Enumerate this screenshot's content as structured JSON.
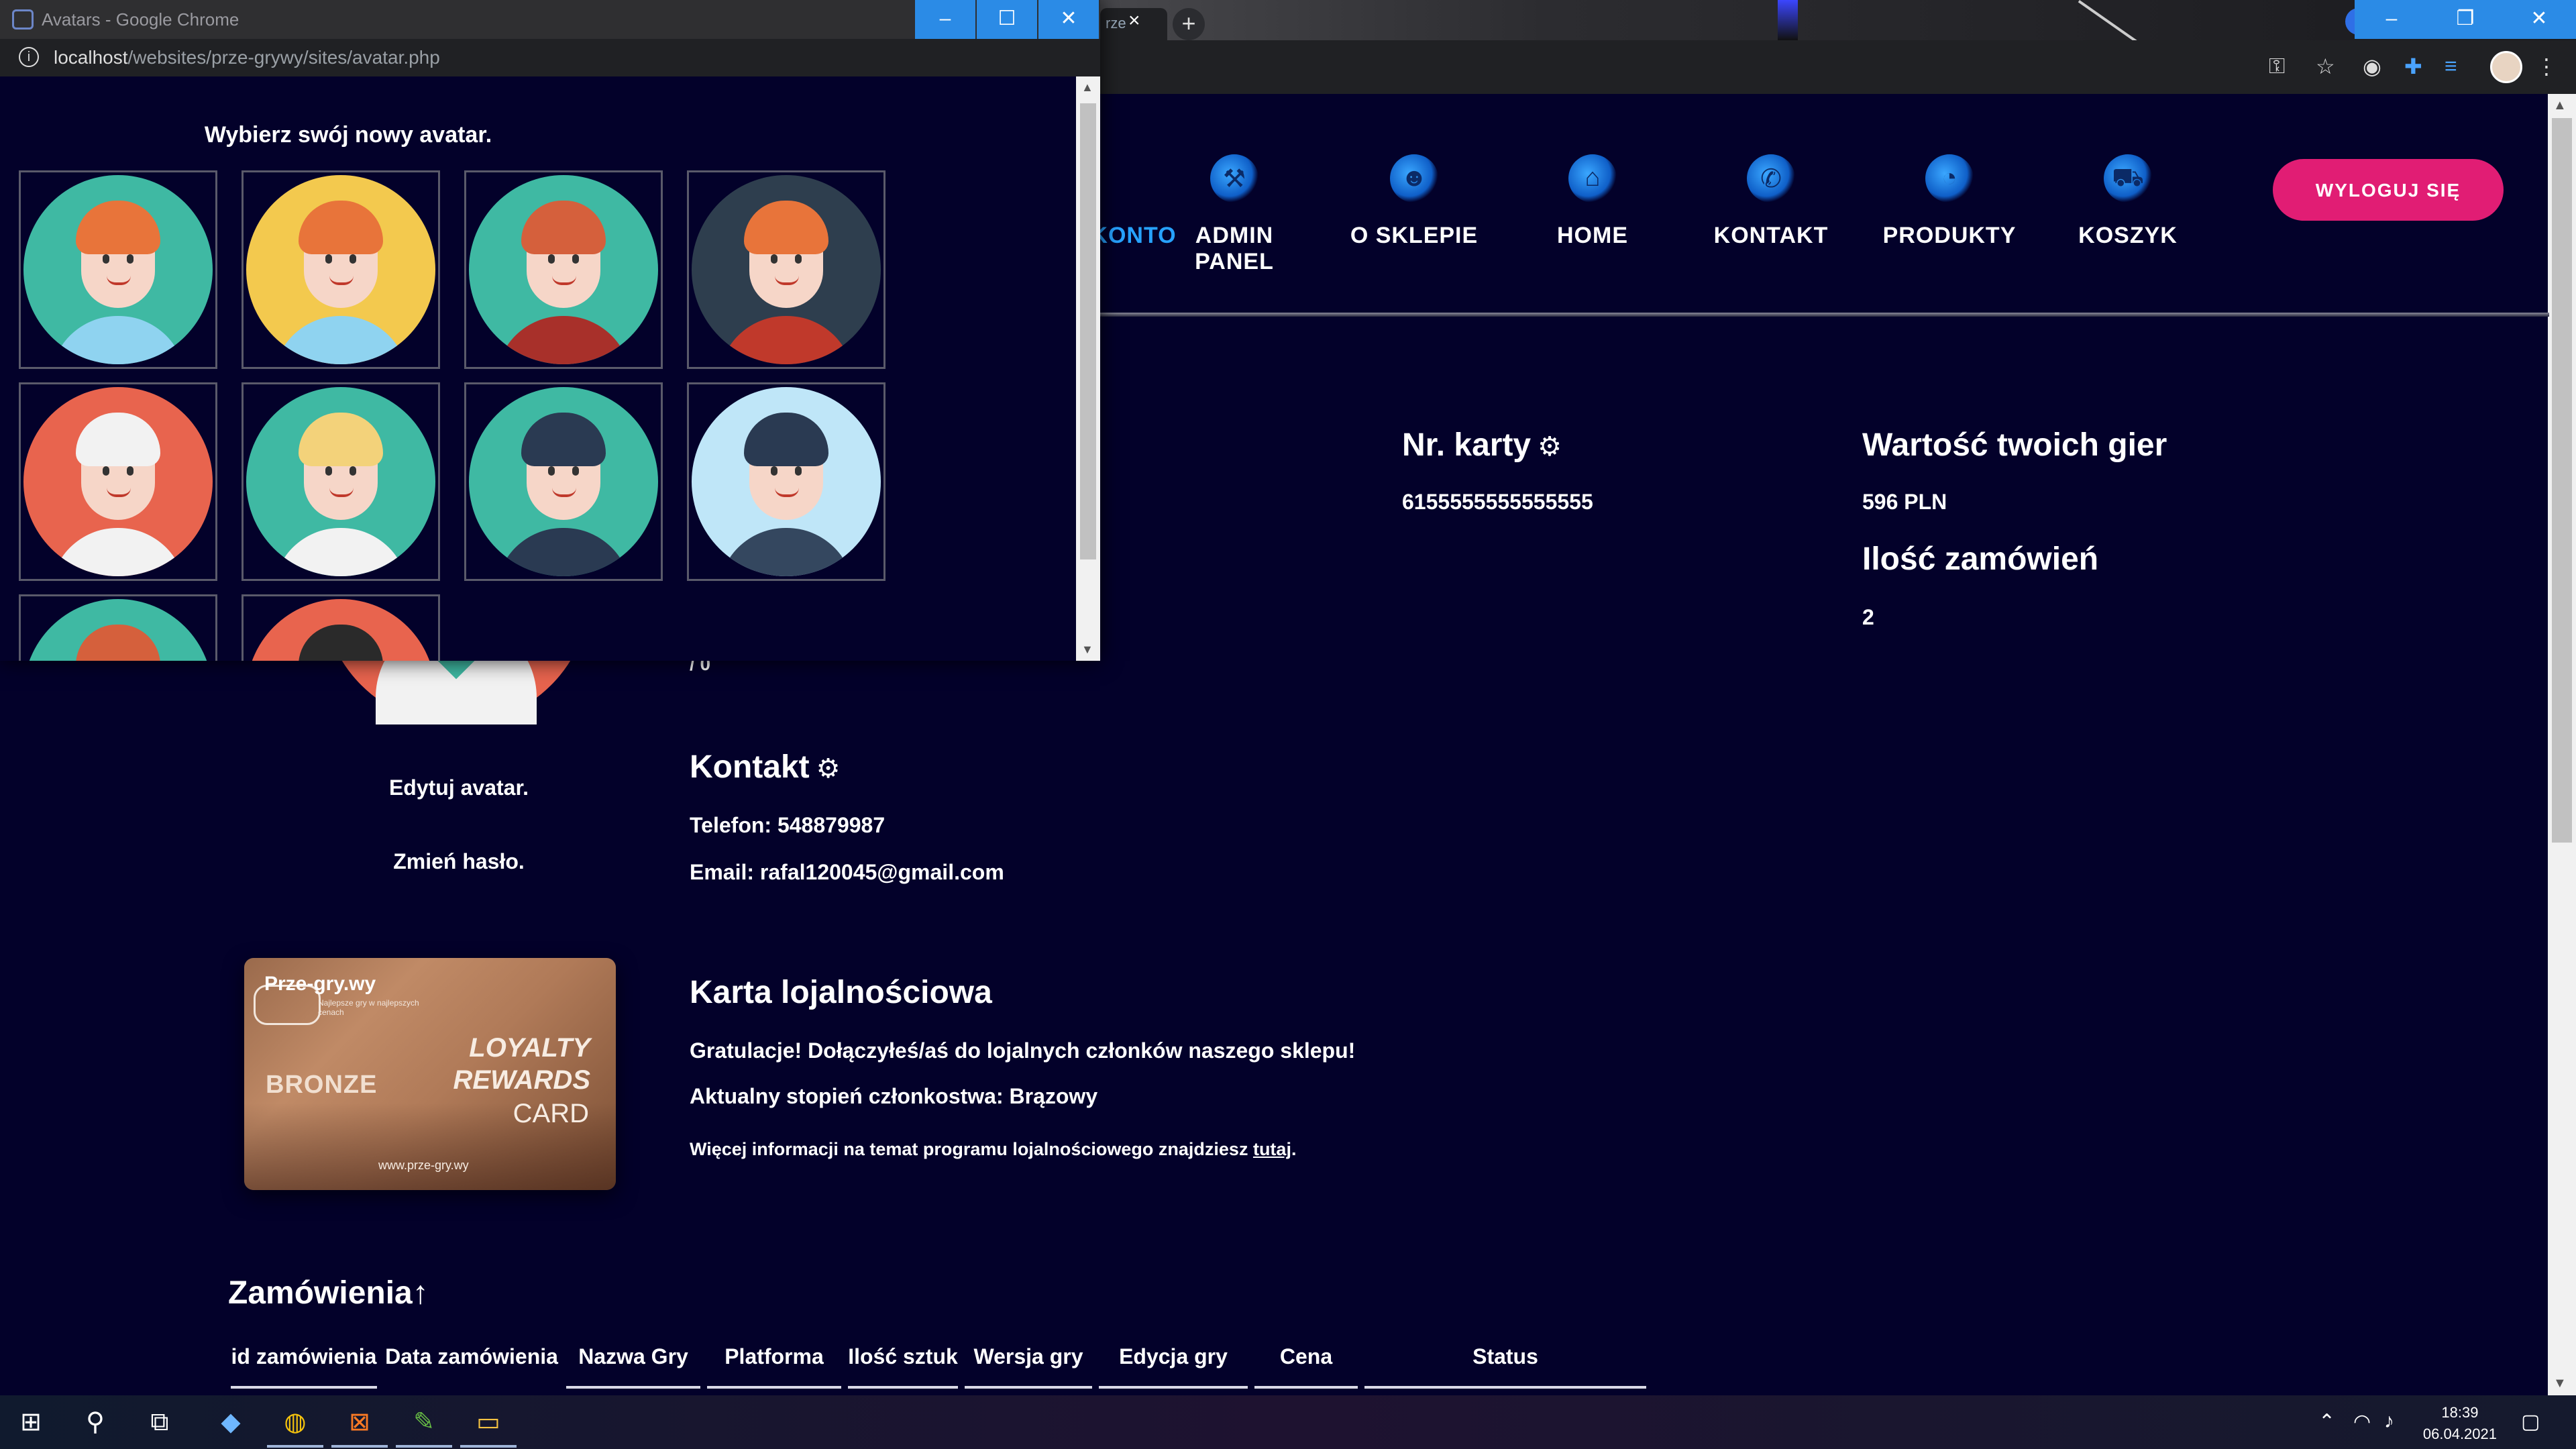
{
  "popup": {
    "window_title": "Avatars - Google Chrome",
    "url_host": "localhost",
    "url_path": "/websites/prze-grywy/sites/avatar.php",
    "heading": "Wybierz swój nowy avatar.",
    "avatars": [
      {
        "name": "boy-redhair",
        "bg": "#3fb9a3",
        "hair": "#e8743a",
        "body": "#8fd3f0"
      },
      {
        "name": "girl-blonde",
        "bg": "#f3c94e",
        "hair": "#e8743a",
        "body": "#8fd3f0"
      },
      {
        "name": "man-redhair",
        "bg": "#3fb9a3",
        "hair": "#d5603c",
        "body": "#a8302a"
      },
      {
        "name": "woman-redhair",
        "bg": "#2e3e4e",
        "hair": "#e8743a",
        "body": "#c0392b"
      },
      {
        "name": "doctor",
        "bg": "#e8644e",
        "hair": "#f2f2f2",
        "body": "#f2f2f2"
      },
      {
        "name": "nurse",
        "bg": "#3fb9a3",
        "hair": "#f3d27a",
        "body": "#f2f2f2"
      },
      {
        "name": "policeman",
        "bg": "#3fb9a3",
        "hair": "#2a3a52",
        "body": "#2a3a52"
      },
      {
        "name": "policewoman",
        "bg": "#bfe6f8",
        "hair": "#2a3a52",
        "body": "#34475f"
      },
      {
        "name": "man-partial",
        "bg": "#3fb9a3",
        "hair": "#d5603c",
        "body": "#f2f2f2"
      },
      {
        "name": "soldier-partial",
        "bg": "#e8644e",
        "hair": "#2a2a2a",
        "body": "#444"
      }
    ]
  },
  "nav": {
    "items": [
      {
        "label": "KONTO",
        "icon": "user-icon",
        "active": true
      },
      {
        "label": "ADMIN PANEL",
        "icon": "admin-icon",
        "active": false
      },
      {
        "label": "O SKLEPIE",
        "icon": "about-icon",
        "active": false
      },
      {
        "label": "HOME",
        "icon": "home-icon",
        "active": false
      },
      {
        "label": "KONTAKT",
        "icon": "phone-icon",
        "active": false
      },
      {
        "label": "PRODUKTY",
        "icon": "gamepad-icon",
        "active": false
      },
      {
        "label": "KOSZYK",
        "icon": "cart-icon",
        "active": false
      }
    ],
    "logout_label": "WYLOGUJ SIĘ",
    "accent": "#27a2ff",
    "logout_color": "#e11d74"
  },
  "account": {
    "card_title": "Nr. karty",
    "card_number": "6155555555555555",
    "games_value_title": "Wartość twoich gier",
    "games_value": "596 PLN",
    "orders_count_title": "Ilość zamówień",
    "orders_count": "2",
    "partial_value": "/ 0",
    "edit_avatar": "Edytuj avatar.",
    "change_password": "Zmień hasło.",
    "contact_title": "Kontakt",
    "phone": "Telefon: 548879987",
    "email": "Email: rafal120045@gmail.com"
  },
  "loyalty": {
    "title": "Karta lojalnościowa",
    "congrats": "Gratulacje! Dołączyłeś/aś do lojalnych członków naszego sklepu!",
    "level": "Aktualny stopień członkostwa: Brązowy",
    "more_info_prefix": "Więcej informacji na temat programu lojalnościowego znajdziesz ",
    "more_info_link": "tutaj",
    "more_info_suffix": ".",
    "card": {
      "brand": "Prze-gry.wy",
      "brand_sub": "Najlepsze gry w najlepszych cenach",
      "tier": "BRONZE",
      "line1": "LOYALTY",
      "line2": "REWARDS",
      "line3": "CARD",
      "url": "www.prze-gry.wy"
    }
  },
  "orders": {
    "title": "Zamówienia↑",
    "columns": [
      "id zamówienia",
      "Data zamówienia",
      "Nazwa Gry",
      "Platforma",
      "Ilość sztuk",
      "Wersja gry",
      "Edycja gry",
      "Cena",
      "Status"
    ]
  },
  "taskbar": {
    "time": "18:39",
    "date": "06.04.2021"
  }
}
